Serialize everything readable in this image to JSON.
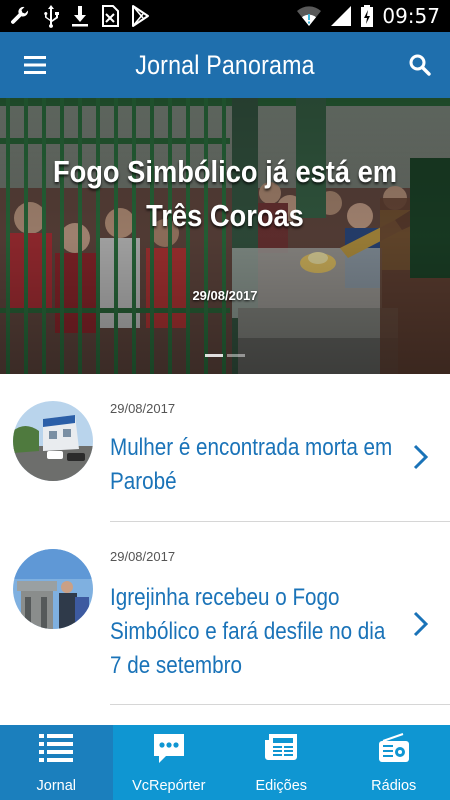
{
  "status_bar": {
    "time": "09:57",
    "left_icons": [
      "wrench-icon",
      "usb-icon",
      "download-icon",
      "sim-icon",
      "play-store-icon"
    ],
    "right_icons": [
      "wifi-icon",
      "signal-icon",
      "battery-charging-icon"
    ]
  },
  "app_bar": {
    "title": "Jornal Panorama",
    "menu_icon": "hamburger-menu-icon",
    "search_icon": "search-icon",
    "color": "#1f6fad"
  },
  "hero": {
    "title": "Fogo Simbólico já está em Três Coroas",
    "date": "29/08/2017",
    "slide_count": 2,
    "active_slide": 0
  },
  "news": [
    {
      "date": "29/08/2017",
      "title": "Mulher é encontrada morta em Parobé"
    },
    {
      "date": "29/08/2017",
      "title": "Igrejinha recebeu o Fogo Simbólico e fará desfile no dia 7 de setembro"
    }
  ],
  "bottom_nav": {
    "active": "Jornal",
    "colors": {
      "bar": "#0f96d2",
      "active": "#1b7fbd"
    },
    "tabs": [
      {
        "label": "Jornal",
        "icon": "list-icon"
      },
      {
        "label": "VcRepórter",
        "icon": "chat-bubble-icon"
      },
      {
        "label": "Edições",
        "icon": "newspaper-icon"
      },
      {
        "label": "Rádios",
        "icon": "radio-icon"
      }
    ]
  }
}
